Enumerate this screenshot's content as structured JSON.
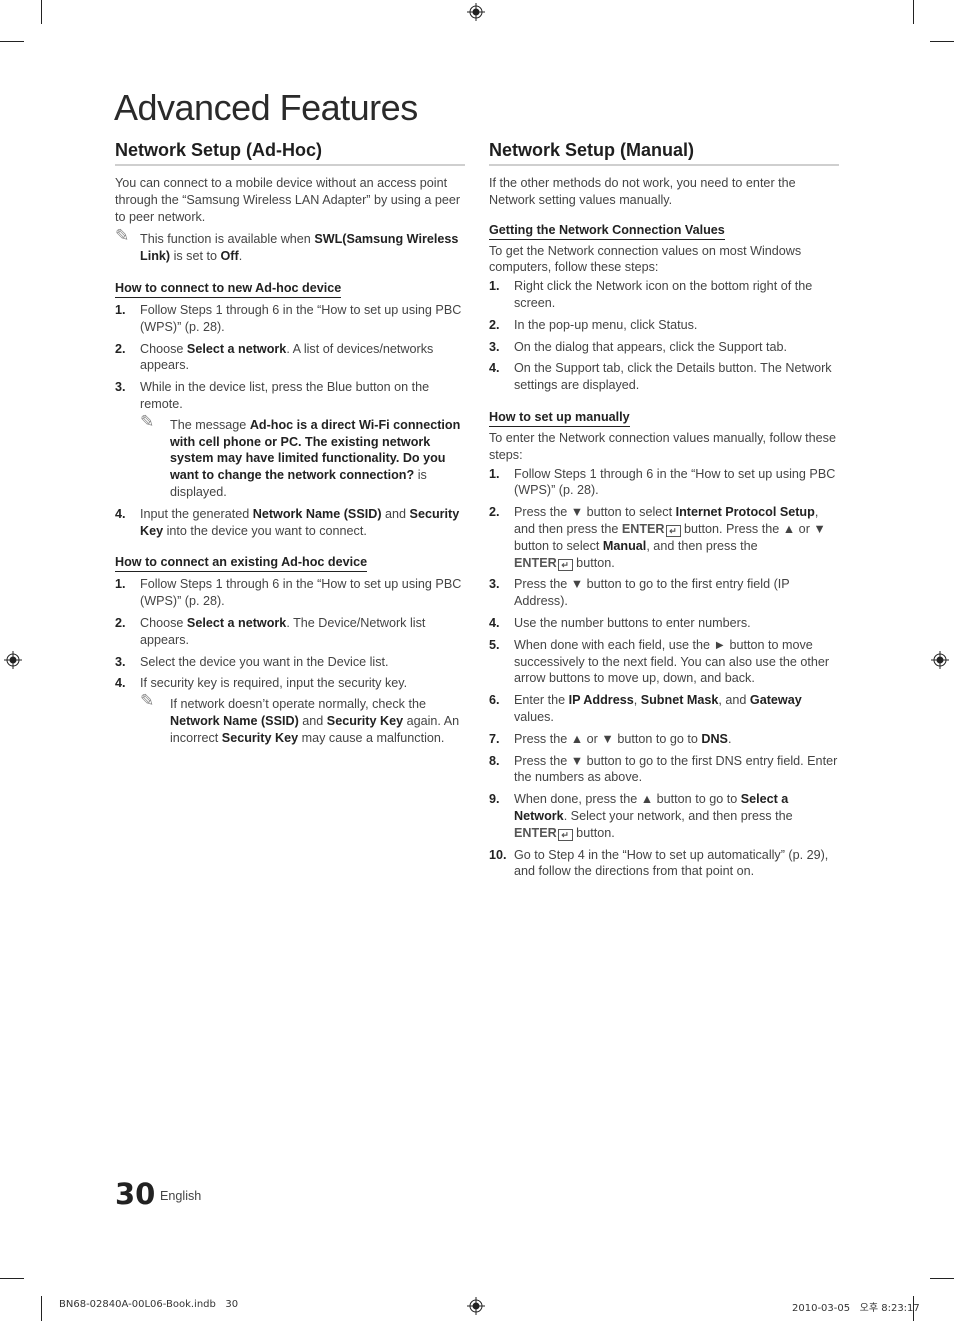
{
  "page": {
    "title": "Advanced Features",
    "page_number": "30",
    "language": "English",
    "slug_file": "BN68-02840A-00L06-Book.indb   30",
    "slug_datetime": "2010-03-05   오후 8:23:17"
  },
  "left": {
    "title": "Network Setup (Ad-Hoc)",
    "intro": "You can connect to a mobile device without an access point through the “Samsung Wireless LAN Adapter” by using a peer to peer network.",
    "note": {
      "pre": "This function is available when ",
      "b1": "SWL(Samsung Wireless Link)",
      "mid": " is set to ",
      "b2": "Off",
      "post": "."
    },
    "new_device": {
      "heading": "How to connect to new Ad-hoc device",
      "steps": [
        {
          "num": "1.",
          "text": "Follow Steps 1 through 6 in the “How to set up using PBC (WPS)” (p. 28)."
        },
        {
          "num": "2.",
          "pre": "Choose ",
          "bold": "Select a network",
          "post": ". A list of devices/networks appears."
        },
        {
          "num": "3.",
          "text": "While in the device list, press the Blue button on the remote.",
          "note_pre": "The message ",
          "note_bold": "Ad-hoc is a direct Wi-Fi connection with cell phone or PC. The existing network system may have limited functionality. Do you want to change the network connection?",
          "note_post": " is displayed."
        },
        {
          "num": "4.",
          "pre": "Input the generated ",
          "bold": "Network Name (SSID)",
          "mid": " and ",
          "bold2": "Security Key",
          "post": " into the device you want to connect."
        }
      ]
    },
    "existing_device": {
      "heading": "How to connect an existing Ad-hoc device",
      "steps": [
        {
          "num": "1.",
          "text": "Follow Steps 1 through 6 in the “How to set up using PBC (WPS)” (p. 28)."
        },
        {
          "num": "2.",
          "pre": "Choose ",
          "bold": "Select a network",
          "post": ". The Device/Network list appears."
        },
        {
          "num": "3.",
          "text": "Select the device you want in the Device list."
        },
        {
          "num": "4.",
          "text": "If security key is required, input the security key.",
          "note_a": "If network doesn’t operate normally, check the ",
          "note_b1": "Network Name (SSID)",
          "note_c": " and ",
          "note_b2": "Security Key",
          "note_d": " again. An incorrect ",
          "note_b3": "Security Key",
          "note_e": " may cause a malfunction."
        }
      ]
    }
  },
  "right": {
    "title": "Network Setup (Manual)",
    "intro": "If the other methods do not work, you need to enter the Network setting values manually.",
    "getting_values": {
      "heading": "Getting the Network Connection Values",
      "intro": "To get the Network connection values on most Windows computers, follow these steps:",
      "steps": [
        {
          "num": "1.",
          "text": "Right click the Network icon on the bottom right of the screen."
        },
        {
          "num": "2.",
          "text": "In the pop-up menu, click Status."
        },
        {
          "num": "3.",
          "text": "On the dialog that appears, click the Support tab."
        },
        {
          "num": "4.",
          "text": "On the Support tab, click the Details button. The Network settings are displayed."
        }
      ]
    },
    "manual": {
      "heading": "How to set up manually",
      "intro": "To enter the Network connection values manually, follow these steps:",
      "enter_label": "ENTER",
      "enter_glyph": "↵",
      "steps": {
        "s1": {
          "num": "1.",
          "text": "Follow Steps 1 through 6 in the “How to set up using PBC (WPS)” (p. 28)."
        },
        "s2": {
          "num": "2.",
          "a": "Press the ▼ button to select ",
          "b": "Internet Protocol Setup",
          "c": ", and then press the ",
          "d": " button. Press the ▲ or ▼ button to select ",
          "e": "Manual",
          "f": ", and then press the ",
          "g": " button."
        },
        "s3": {
          "num": "3.",
          "text": "Press the ▼ button to go to the first entry field (IP Address)."
        },
        "s4": {
          "num": "4.",
          "text": "Use the number buttons to enter numbers."
        },
        "s5": {
          "num": "5.",
          "text": "When done with each field, use the ► button to move successively to the next field. You can also use the other arrow buttons to move up, down, and back."
        },
        "s6": {
          "num": "6.",
          "a": "Enter the ",
          "b": "IP Address",
          "c": ", ",
          "d": "Subnet Mask",
          "e": ", and ",
          "f": "Gateway",
          "g": " values."
        },
        "s7": {
          "num": "7.",
          "a": "Press the ▲ or ▼ button to go to ",
          "b": "DNS",
          "c": "."
        },
        "s8": {
          "num": "8.",
          "text": "Press the ▼ button to go to the first DNS entry field. Enter the numbers as above."
        },
        "s9": {
          "num": "9.",
          "a": "When done, press the ▲ button to go to ",
          "b": "Select a Network",
          "c": ". Select your network, and then press the ",
          "d": " button."
        },
        "s10": {
          "num": "10.",
          "text": "Go to Step 4 in the “How to set up automatically” (p. 29), and follow the directions from that point on."
        }
      }
    }
  }
}
